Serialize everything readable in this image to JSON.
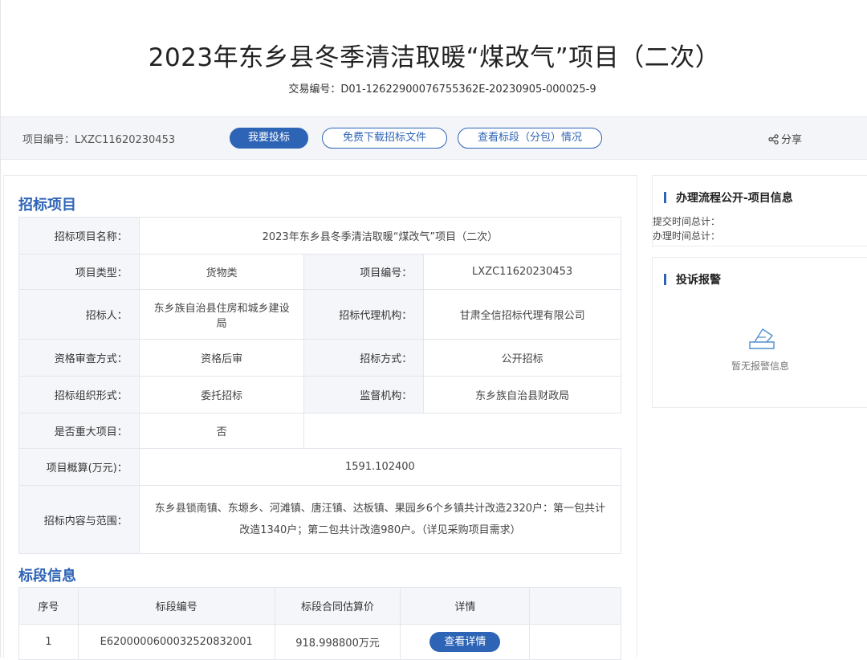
{
  "header": {
    "title": "2023年东乡县冬季清洁取暖“煤改气”项目（二次）",
    "transaction_code": "交易编号：D01-12622900076755362E-20230905-000025-9"
  },
  "toolbar": {
    "project_no": "项目编号：LXZC11620230453",
    "bid_button": "我要投标",
    "download_button": "免费下载招标文件",
    "segment_button": "查看标段（分包）情况",
    "share_label": "分享"
  },
  "bid_project": {
    "section_title": "招标项目",
    "name_label": "招标项目名称：",
    "name_value": "2023年东乡县冬季清洁取暖“煤改气”项目（二次）",
    "type_label": "项目类型：",
    "type_value": "货物类",
    "no_label": "项目编号：",
    "no_value": "LXZC11620230453",
    "tenderer_label": "招标人：",
    "tenderer_value": "东乡族自治县住房和城乡建设局",
    "agency_label": "招标代理机构：",
    "agency_value": "甘肃全信招标代理有限公司",
    "review_label": "资格审查方式：",
    "review_value": "资格后审",
    "method_label": "招标方式：",
    "method_value": "公开招标",
    "org_label": "招标组织形式：",
    "org_value": "委托招标",
    "supervisor_label": "监督机构：",
    "supervisor_value": "东乡族自治县财政局",
    "major_label": "是否重大项目：",
    "major_value": "否",
    "budget_label": "项目概算(万元)：",
    "budget_value": "1591.102400",
    "scope_label": "招标内容与范围：",
    "scope_value": "东乡县锁南镇、东塬乡、河滩镇、唐汪镇、达板镇、果园乡6个乡镇共计改造2320户：第一包共计改造1340户；第二包共计改造980户。（详见采购项目需求）"
  },
  "segments": {
    "section_title": "标段信息",
    "columns": [
      "序号",
      "标段编号",
      "标段合同估算价",
      "详情"
    ],
    "rows": [
      {
        "index": "1",
        "code": "E6200000600032520832001",
        "price": "918.998800万元",
        "detail": "查看详情"
      }
    ]
  },
  "sidebar": {
    "process_title": "办理流程公开-项目信息",
    "submit_total": "提交时间总计：",
    "handle_total": "办理时间总计：",
    "complaint_title": "投诉报警",
    "empty_text": "暂无报警信息"
  },
  "colors": {
    "accent": "#2e64b6",
    "label_bg": "#f4f6f9",
    "toolbar_bg": "#f3f5f8"
  }
}
